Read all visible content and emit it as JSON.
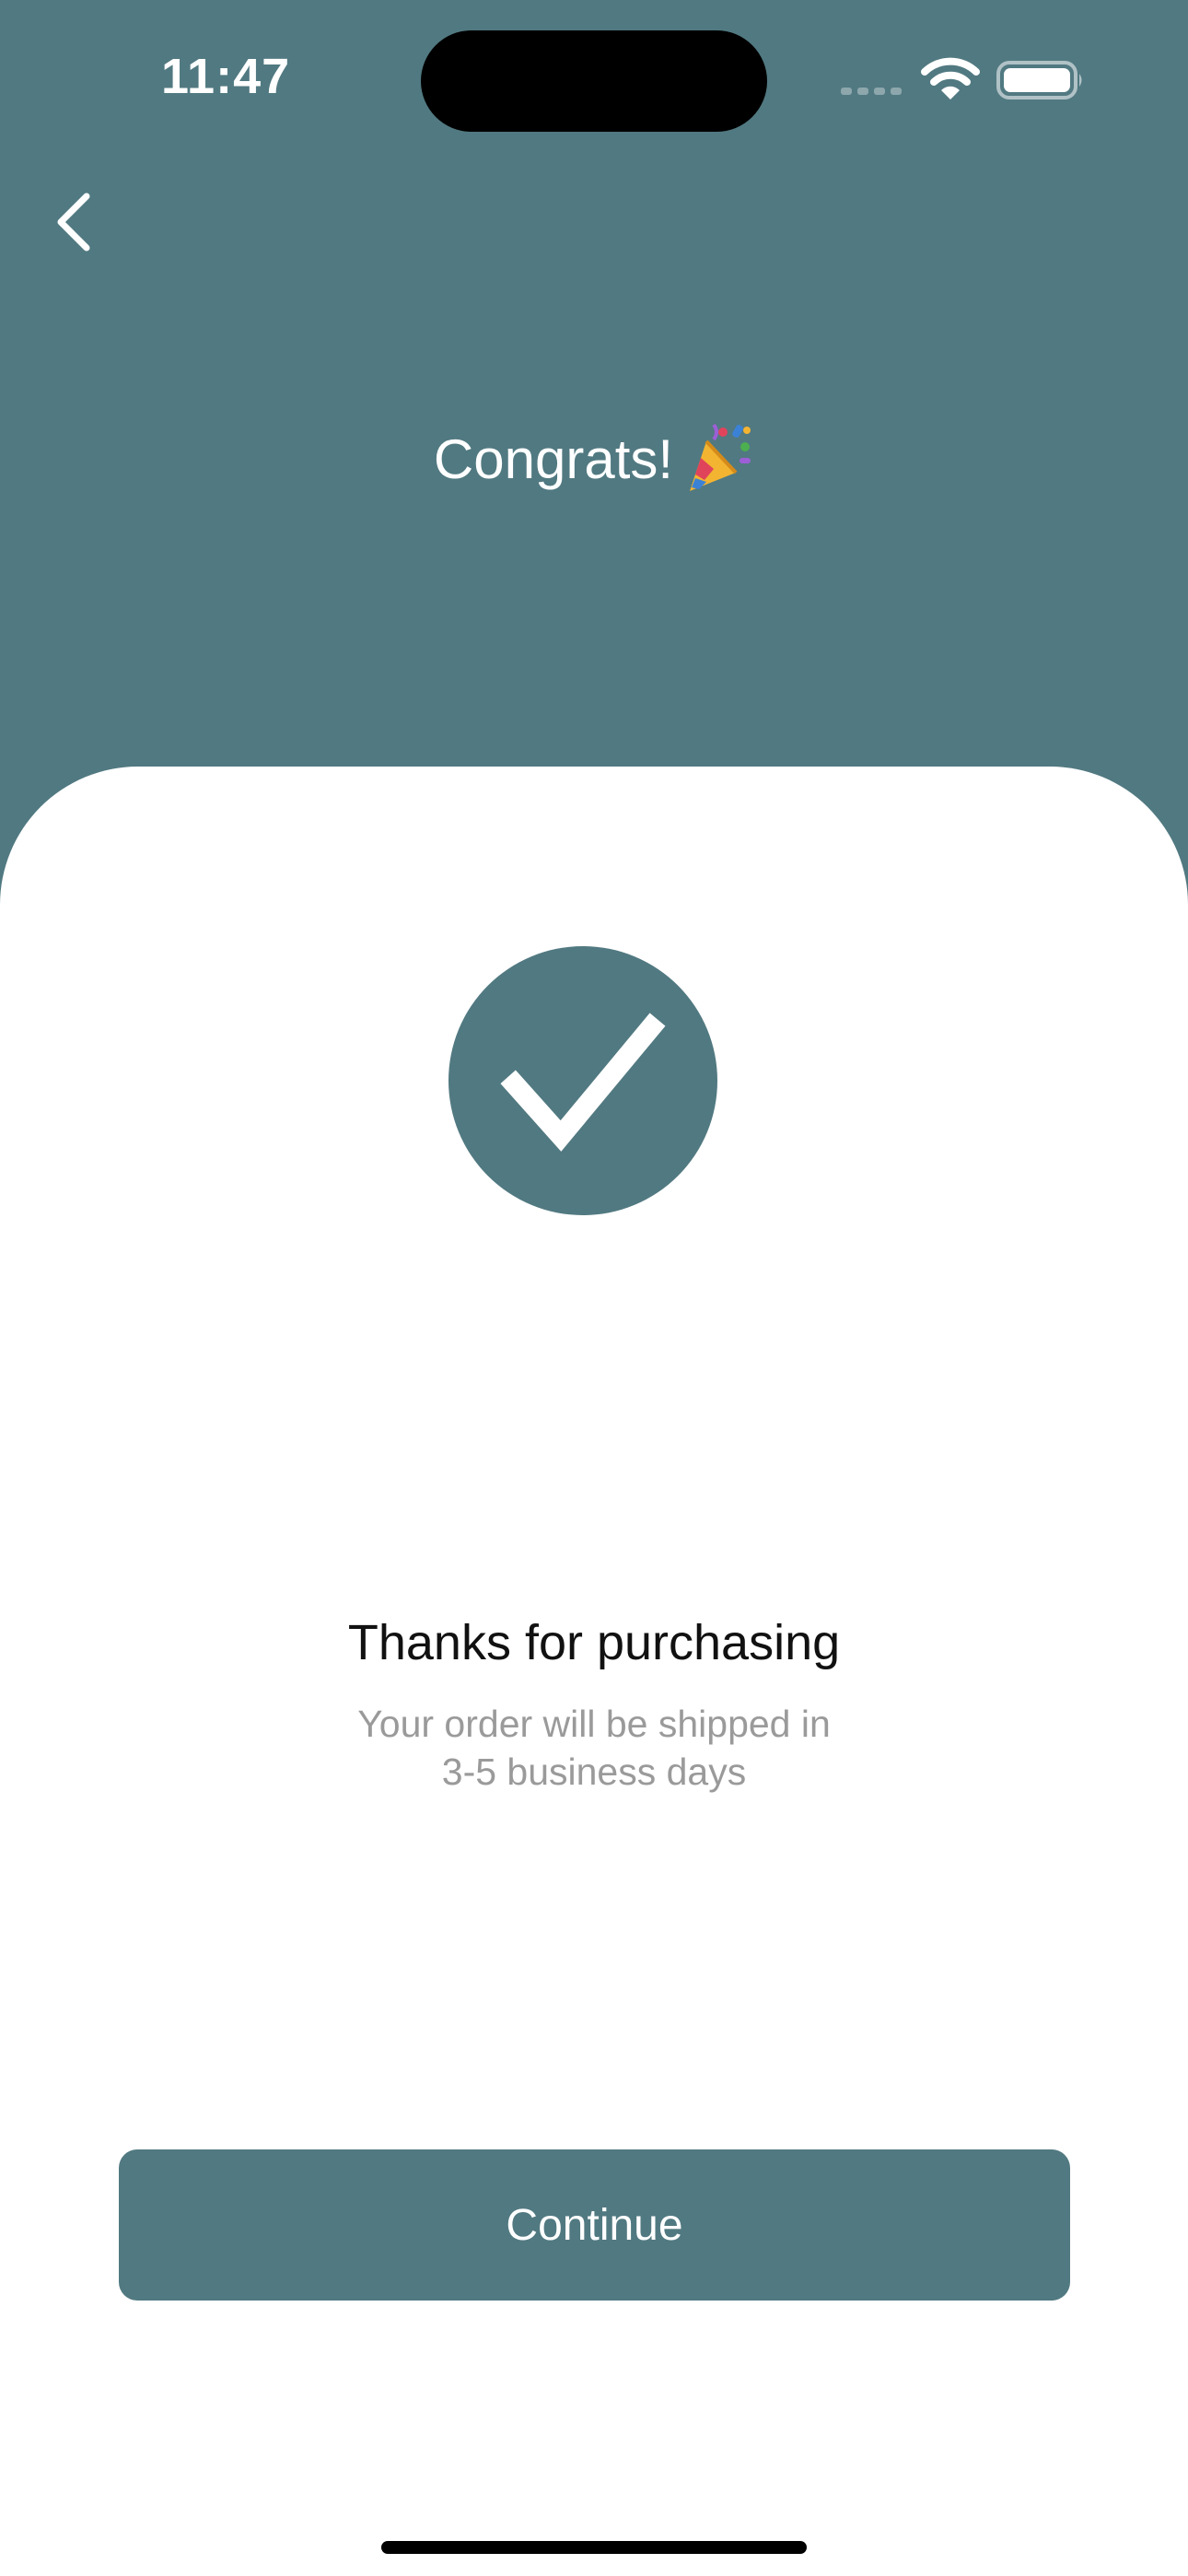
{
  "status_bar": {
    "time": "11:47"
  },
  "nav": {
    "back_icon": "chevron-left-icon"
  },
  "header": {
    "title": "Congrats!",
    "title_emoji": "party-popper-icon"
  },
  "confirmation": {
    "icon": "checkmark-icon",
    "heading": "Thanks for purchasing",
    "message_line1": "Your order will be shipped in",
    "message_line2": "3-5 business days"
  },
  "actions": {
    "continue_label": "Continue"
  },
  "colors": {
    "accent": "#517981",
    "background": "#ffffff",
    "subtext": "#9a9a9a"
  }
}
